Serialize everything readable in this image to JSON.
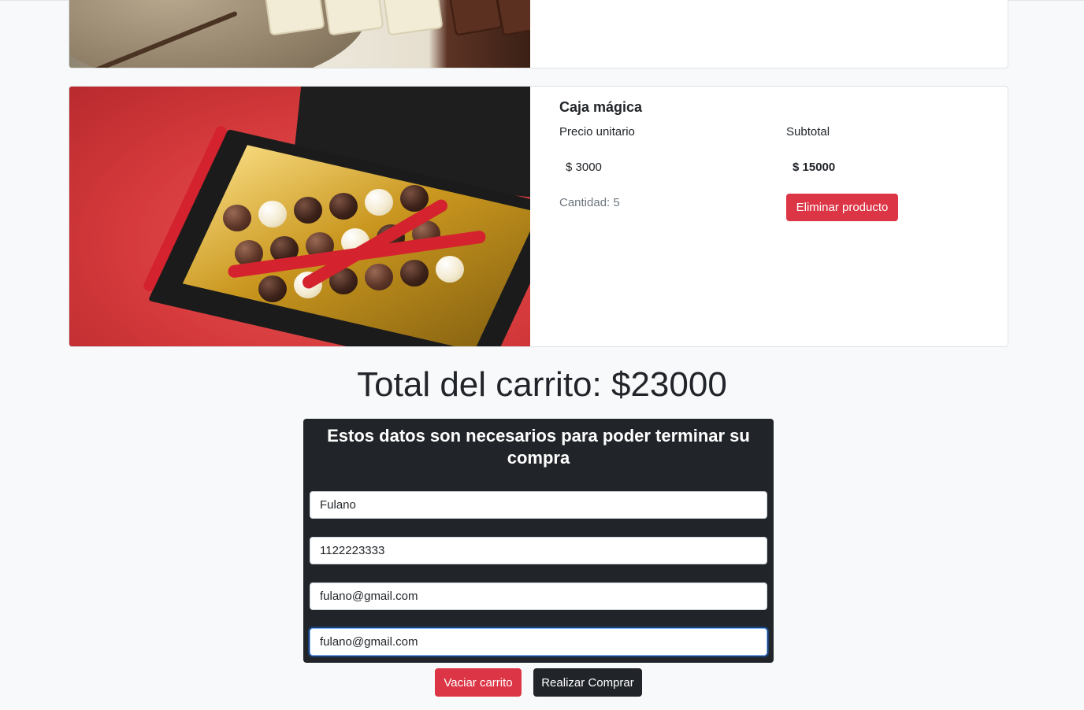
{
  "products": [
    {
      "image_alt": "Chocolate blanco"
    },
    {
      "name": "Caja mágica",
      "price_label": "Precio unitario",
      "price_value": "$ 3000",
      "subtotal_label": "Subtotal",
      "subtotal_value": "$ 15000",
      "quantity": "Cantidad: 5",
      "remove_label": "Eliminar producto"
    }
  ],
  "cart": {
    "total": "Total del carrito: $23000"
  },
  "form": {
    "title": "Estos datos son necesarios para poder terminar su compra",
    "name_value": "Fulano",
    "phone_value": "1122223333",
    "email_value": "fulano@gmail.com",
    "email_confirm_value": "fulano@gmail.com"
  },
  "actions": {
    "clear_label": "Vaciar carrito",
    "buy_label": "Realizar Comprar"
  },
  "colors": {
    "danger": "#dc3545",
    "dark": "#212529",
    "background": "#f8f9fa"
  }
}
